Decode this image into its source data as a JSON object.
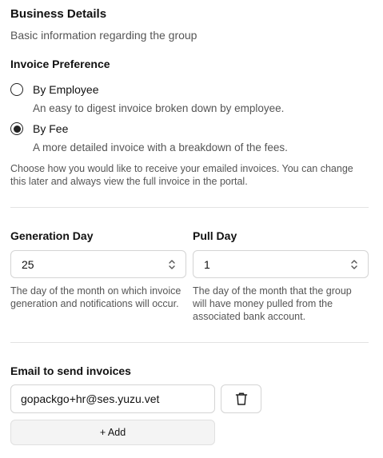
{
  "section": {
    "title": "Business Details",
    "subtitle": "Basic information regarding the group"
  },
  "invoice_preference": {
    "label": "Invoice Preference",
    "options": [
      {
        "label": "By Employee",
        "description": "An easy to digest invoice broken down by employee.",
        "selected": false
      },
      {
        "label": "By Fee",
        "description": "A more detailed invoice with a breakdown of the fees.",
        "selected": true
      }
    ],
    "help": "Choose how you would like to receive your emailed invoices. You can change this later and always view the full invoice in the portal."
  },
  "generation_day": {
    "label": "Generation Day",
    "value": "25",
    "help": "The day of the month on which invoice generation and notifications will occur."
  },
  "pull_day": {
    "label": "Pull Day",
    "value": "1",
    "help": "The day of the month that the group will have money pulled from the associated bank account."
  },
  "email": {
    "label": "Email to send invoices",
    "value": "gopackgo+hr@ses.yuzu.vet",
    "delete_icon": "trash-icon",
    "add_label": "+ Add"
  }
}
